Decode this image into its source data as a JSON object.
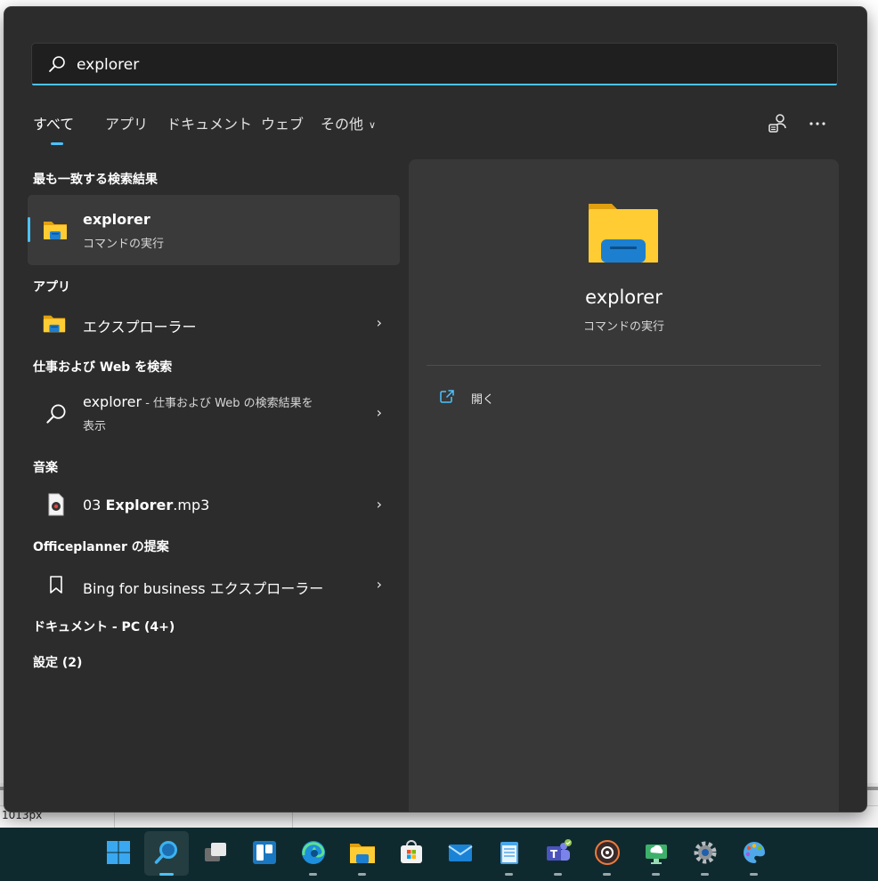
{
  "background_app": {
    "status_text": "1013px"
  },
  "search": {
    "query": "explorer"
  },
  "tabs": [
    {
      "label": "すべて"
    },
    {
      "label": "アプリ"
    },
    {
      "label": "ドキュメント"
    },
    {
      "label": "ウェブ"
    },
    {
      "label": "その他"
    }
  ],
  "sections": {
    "best_match": "最も一致する検索結果",
    "apps": "アプリ",
    "web": "仕事および Web を検索",
    "music": "音楽",
    "officeplanner": "Officeplanner の提案",
    "documents": "ドキュメント - PC (4+)",
    "settings": "設定 (2)"
  },
  "best_match": {
    "title": "explorer",
    "subtitle": "コマンドの実行"
  },
  "apps_result": {
    "title": "エクスプローラー"
  },
  "web_result": {
    "title": "explorer",
    "suffix": " - 仕事および Web の検索結果を",
    "line2": "表示"
  },
  "music_result": {
    "prefix": "03 ",
    "bold": "Explorer",
    "suffix": ".mp3"
  },
  "officeplanner_result": {
    "title": "Bing for business エクスプローラー"
  },
  "preview": {
    "title": "explorer",
    "subtitle": "コマンドの実行",
    "action_open": "開く"
  },
  "colors": {
    "accent": "#4cc2ff",
    "panel_bg": "#2c2c2c",
    "preview_bg": "#383838",
    "taskbar_bg": "#0f2a2f"
  },
  "taskbar": {
    "items": [
      {
        "icon": "windows-start-icon"
      },
      {
        "icon": "search-icon",
        "active": true
      },
      {
        "icon": "task-view-icon"
      },
      {
        "icon": "widgets-icon"
      },
      {
        "icon": "edge-icon",
        "running": true
      },
      {
        "icon": "file-explorer-icon",
        "running": true
      },
      {
        "icon": "microsoft-store-icon"
      },
      {
        "icon": "mail-icon"
      },
      {
        "icon": "notepad-icon",
        "running": true
      },
      {
        "icon": "teams-icon",
        "running": true
      },
      {
        "icon": "media-player-icon",
        "running": true
      },
      {
        "icon": "remote-desktop-icon",
        "running": true
      },
      {
        "icon": "settings-icon",
        "running": true
      },
      {
        "icon": "paint-icon",
        "running": true
      }
    ]
  }
}
